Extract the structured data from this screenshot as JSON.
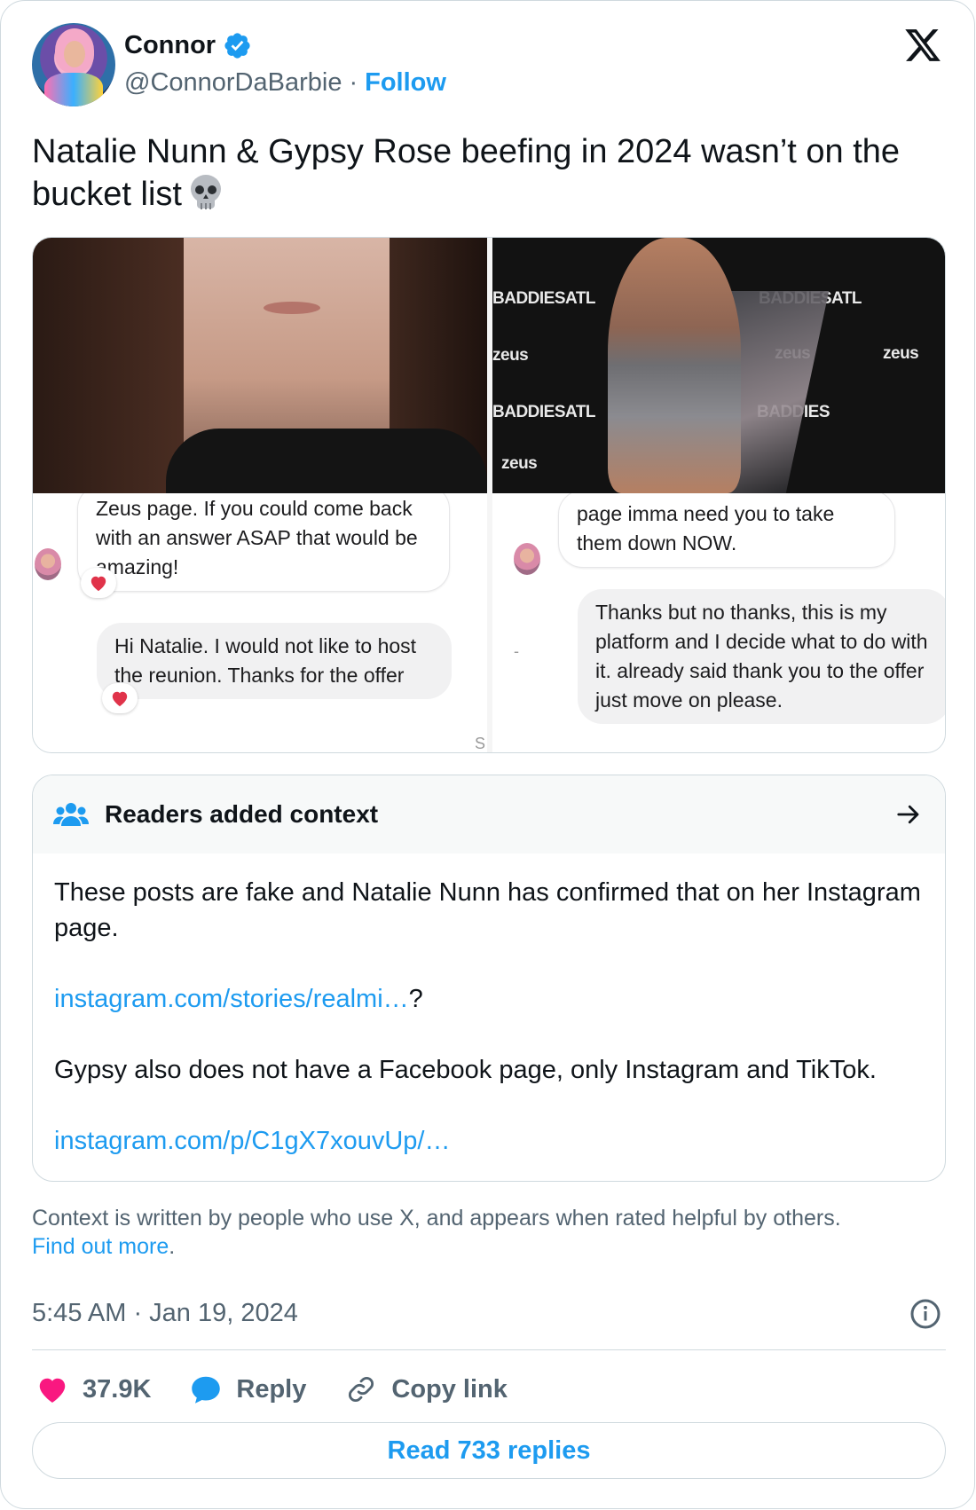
{
  "author": {
    "name": "Connor",
    "handle": "@ConnorDaBarbie",
    "separator": "·",
    "follow_label": "Follow"
  },
  "tweet": {
    "text": "Natalie Nunn & Gypsy Rose beefing in 2024 wasn’t on the bucket list",
    "emoji": "skull-icon"
  },
  "media": {
    "right_photo_watermarks": [
      "zeus",
      "BADDIESATL",
      "zeus",
      "BADDIESATL",
      "zeus",
      "BADDIESATL",
      "zeus",
      "BADDIES"
    ],
    "left_chat": {
      "bubble1": "Zeus page. If you could come back with an answer ASAP that would be amazing!",
      "bubble2": "Hi Natalie. I would not like to host the reunion. Thanks for the offer",
      "stray": "S"
    },
    "right_chat": {
      "bubble1": "page imma need you to take them down NOW.",
      "bubble2": "Thanks but no thanks, this is my platform and I decide what to do with it. already said thank you to the offer just move on please.",
      "stray": "-"
    }
  },
  "context": {
    "title": "Readers added context",
    "paragraph1": "These posts are fake and Natalie Nunn has confirmed that on her Instagram page.",
    "link1": "instagram.com/stories/realmi…",
    "link1_suffix": "?",
    "paragraph2": "Gypsy also does not have a Facebook page, only Instagram and TikTok.",
    "link2": "instagram.com/p/C1gX7xouvUp/…"
  },
  "disclaimer": {
    "text": "Context is written by people who use X, and appears when rated helpful by others.",
    "link": "Find out more",
    "suffix": "."
  },
  "timestamp": "5:45 AM · Jan 19, 2024",
  "actions": {
    "likes": "37.9K",
    "reply": "Reply",
    "copy_link": "Copy link"
  },
  "read_replies": "Read 733 replies",
  "colors": {
    "accent": "#1d9bf0",
    "heart": "#f91880",
    "text": "#0f1419",
    "secondary": "#536471"
  }
}
